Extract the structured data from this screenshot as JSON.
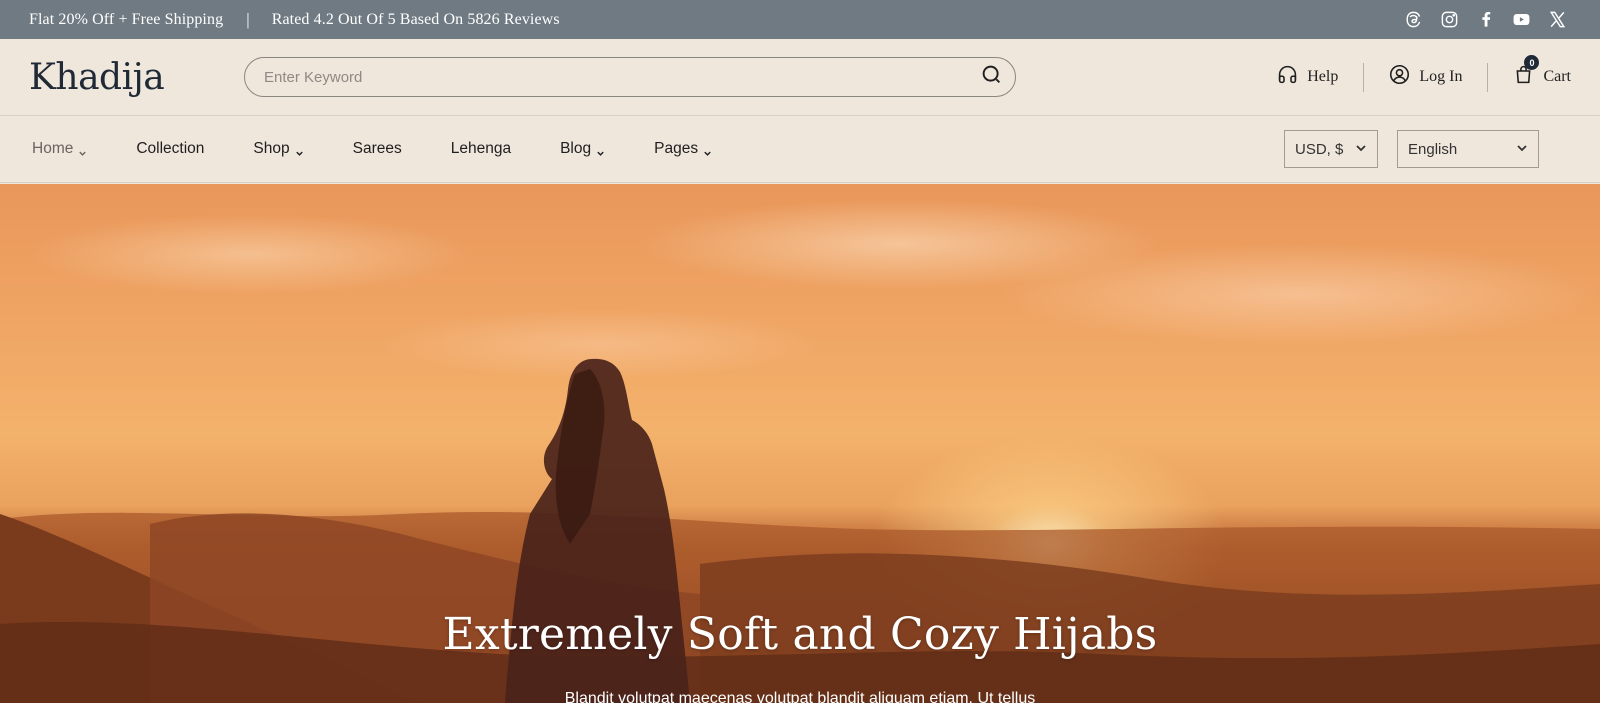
{
  "announcement": {
    "promo": "Flat 20% Off + Free Shipping",
    "separator": "|",
    "rating": "Rated 4.2 Out Of 5 Based On 5826 Reviews",
    "socials": [
      "threads-icon",
      "instagram-icon",
      "facebook-icon",
      "youtube-icon",
      "x-icon"
    ]
  },
  "header": {
    "logo": "Khadija",
    "search_placeholder": "Enter Keyword",
    "help_label": "Help",
    "login_label": "Log In",
    "cart_label": "Cart",
    "cart_count": "0"
  },
  "nav": {
    "items": [
      {
        "label": "Home",
        "has_dropdown": true,
        "active": true
      },
      {
        "label": "Collection",
        "has_dropdown": false
      },
      {
        "label": "Shop",
        "has_dropdown": true
      },
      {
        "label": "Sarees",
        "has_dropdown": false
      },
      {
        "label": "Lehenga",
        "has_dropdown": false
      },
      {
        "label": "Blog",
        "has_dropdown": true
      },
      {
        "label": "Pages",
        "has_dropdown": true
      }
    ],
    "currency": "USD, $",
    "language": "English"
  },
  "hero": {
    "title": "Extremely Soft and Cozy Hijabs",
    "subtitle": "Blandit volutpat maecenas volutpat blandit aliquam etiam. Ut tellus"
  },
  "colors": {
    "topbar_bg": "#6f7a82",
    "page_bg": "#efe6dc",
    "logo": "#1f2a36"
  }
}
